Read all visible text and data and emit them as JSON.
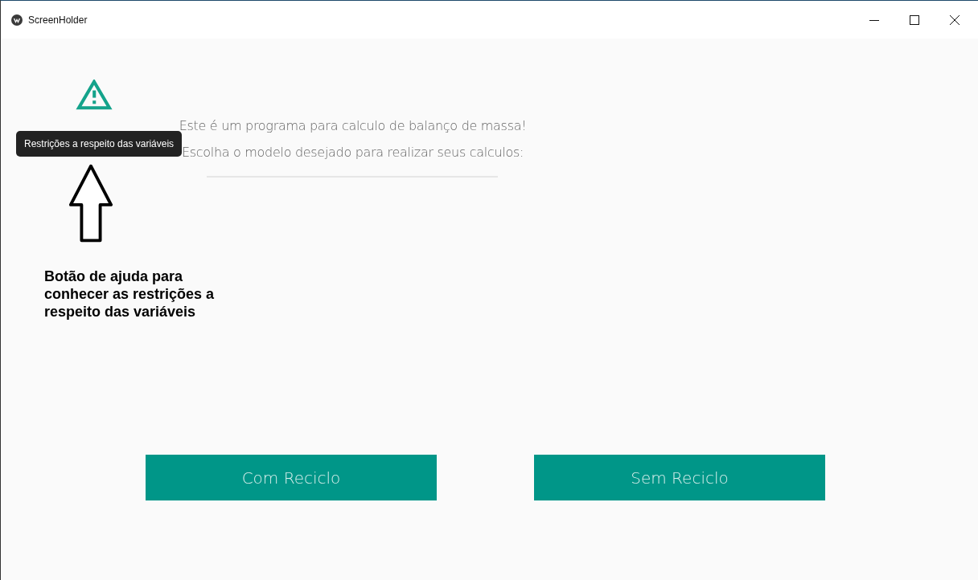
{
  "window": {
    "title": "ScreenHolder"
  },
  "help": {
    "tooltip": "Restrições a respeito das variáveis"
  },
  "intro": [
    "Este é um programa para calculo de balanço de massa!",
    "Escolha o modelo desejado para realizar seus calculos:"
  ],
  "buttons": [
    "Com Reciclo",
    "Sem Reciclo"
  ],
  "annotation": {
    "note": "Botão de ajuda para conhecer as restrições a respeito das variáveis"
  }
}
